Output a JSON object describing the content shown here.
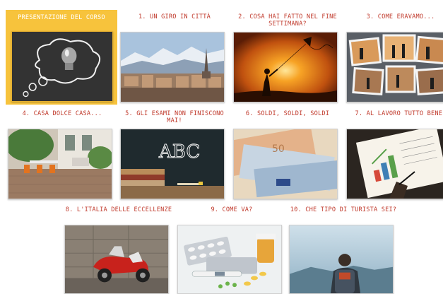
{
  "lessons": [
    {
      "title": "PRESENTAZIONE DEL CORSO",
      "image": "lightbulb-chalkboard"
    },
    {
      "title": "1. UN GIRO IN CITTÀ",
      "image": "turin-cityscape"
    },
    {
      "title": "2. COSA HAI FATTO NEL FINE SETTIMANA?",
      "image": "kite-sunset"
    },
    {
      "title": "3. COME ERAVAMO...",
      "image": "photo-collage"
    },
    {
      "title": "4. CASA DOLCE CASA...",
      "image": "patio-garden"
    },
    {
      "title": "5. GLI ESAMI NON FINISCONO MAI!",
      "image": "abc-blackboard"
    },
    {
      "title": "6. SOLDI, SOLDI, SOLDI",
      "image": "euro-banknotes"
    },
    {
      "title": "7. AL LAVORO TUTTO BENE?",
      "image": "notebook-chart"
    },
    {
      "title": "8. L'ITALIA DELLE ECCELLENZE",
      "image": "red-vespa"
    },
    {
      "title": "9. COME VA?",
      "image": "pills-thermometer"
    },
    {
      "title": "10. CHE TIPO DI TURISTA SEI?",
      "image": "hiker-backpack"
    }
  ],
  "colors": {
    "active_bg": "#f7c33c",
    "title_red": "#c0392b",
    "title_active": "#ffffff"
  },
  "blackboard_text": "ABC"
}
